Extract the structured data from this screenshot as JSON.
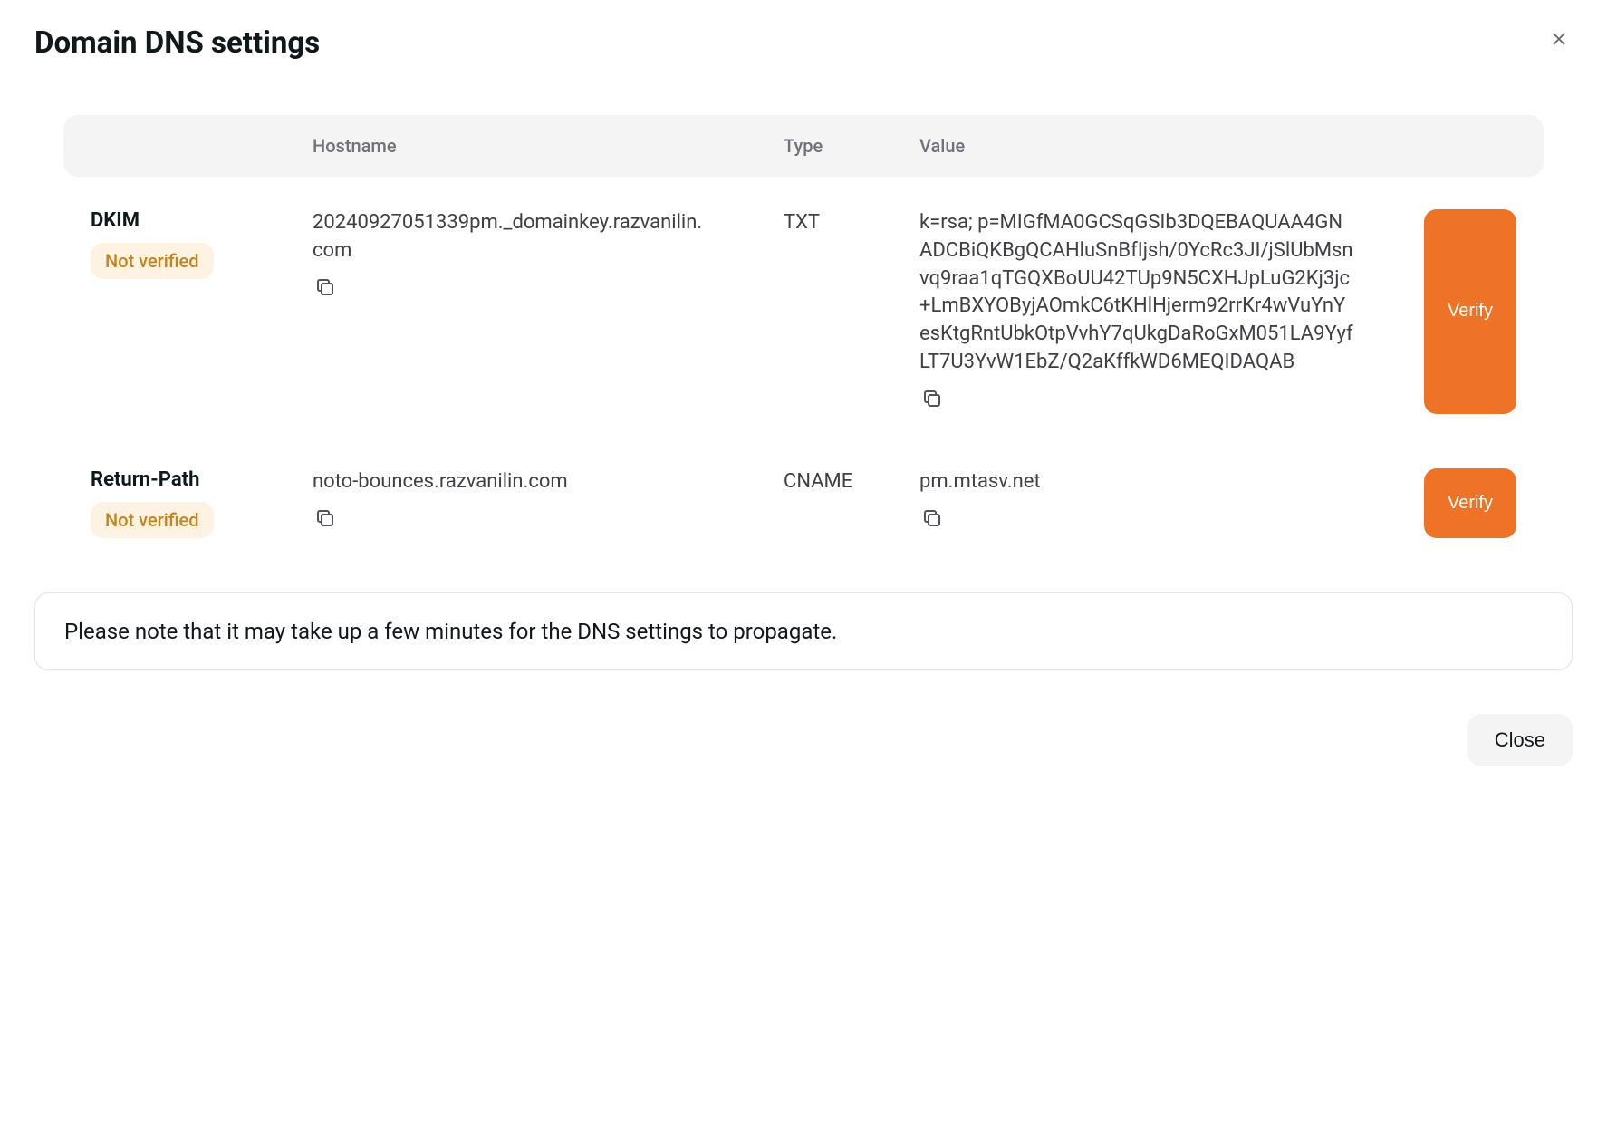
{
  "modal": {
    "title": "Domain DNS settings",
    "note": "Please note that it may take up a few minutes for the DNS settings to propagate.",
    "close_button": "Close"
  },
  "columns": {
    "hostname": "Hostname",
    "type": "Type",
    "value": "Value"
  },
  "records": [
    {
      "label": "DKIM",
      "status": "Not verified",
      "hostname": "20240927051339pm._domainkey.razvanilin.com",
      "type": "TXT",
      "value": "k=rsa; p=MIGfMA0GCSqGSIb3DQEBAQUAA4GNADCBiQKBgQCAHluSnBfIjsh/0YcRc3JI/jSlUbMsnvq9raa1qTGQXBoUU42TUp9N5CXHJpLuG2Kj3jc+LmBXYOByjAOmkC6tKHlHjerm92rrKr4wVuYnYesKtgRntUbkOtpVvhY7qUkgDaRoGxM051LA9YyfLT7U3YvW1EbZ/Q2aKffkWD6MEQIDAQAB",
      "action": "Verify"
    },
    {
      "label": "Return-Path",
      "status": "Not verified",
      "hostname": "noto-bounces.razvanilin.com",
      "type": "CNAME",
      "value": "pm.mtasv.net",
      "action": "Verify"
    }
  ]
}
